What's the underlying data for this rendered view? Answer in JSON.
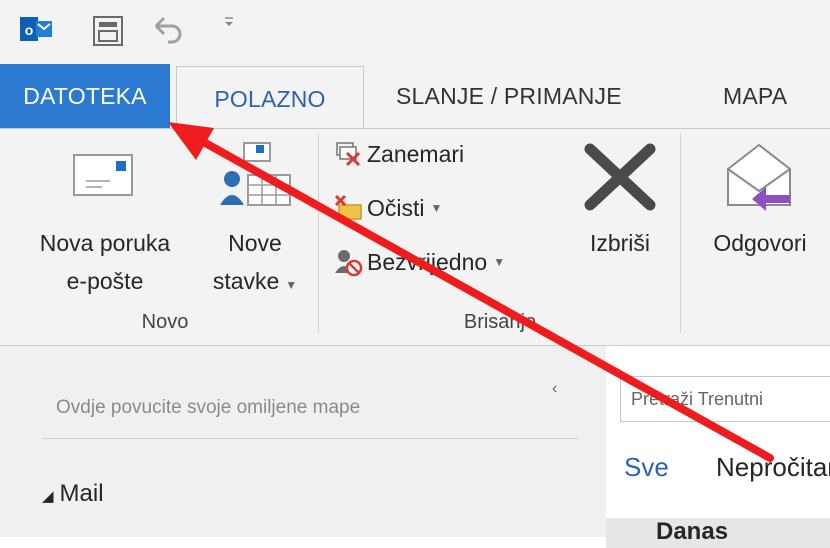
{
  "quick_access": {
    "icons": [
      "outlook-logo-icon",
      "send-receive-all-icon",
      "undo-icon",
      "customize-toolbar-icon"
    ]
  },
  "tabs": [
    {
      "label": "DATOTEKA",
      "active": false,
      "highlight": true
    },
    {
      "label": "POLAZNO",
      "active": true
    },
    {
      "label": "SLANJE / PRIMANJE",
      "active": false
    },
    {
      "label": "MAPA",
      "active": false
    }
  ],
  "ribbon": {
    "novo": {
      "group_label": "Novo",
      "new_email": {
        "line1": "Nova poruka",
        "line2": "e-pošte"
      },
      "new_items": {
        "line1": "Nove",
        "line2": "stavke"
      }
    },
    "brisanje": {
      "group_label": "Brisanje",
      "ignore": "Zanemari",
      "clean_up": "Očisti",
      "junk": "Bezvrijedno",
      "delete": "Izbriši"
    },
    "reply": "Odgovori"
  },
  "folder_pane": {
    "favorites_hint": "Ovdje povucite svoje omiljene mape",
    "collapse_glyph": "‹",
    "mail_group": "Mail"
  },
  "message_list": {
    "search_placeholder": "Pretraži Trenutni",
    "filter_all": "Sve",
    "filter_unread": "Nepročitano",
    "group_today": "Danas"
  },
  "colors": {
    "accent": "#2b79d1",
    "arrow": "#ee1c1c",
    "tab_active_text": "#2b63b0"
  }
}
